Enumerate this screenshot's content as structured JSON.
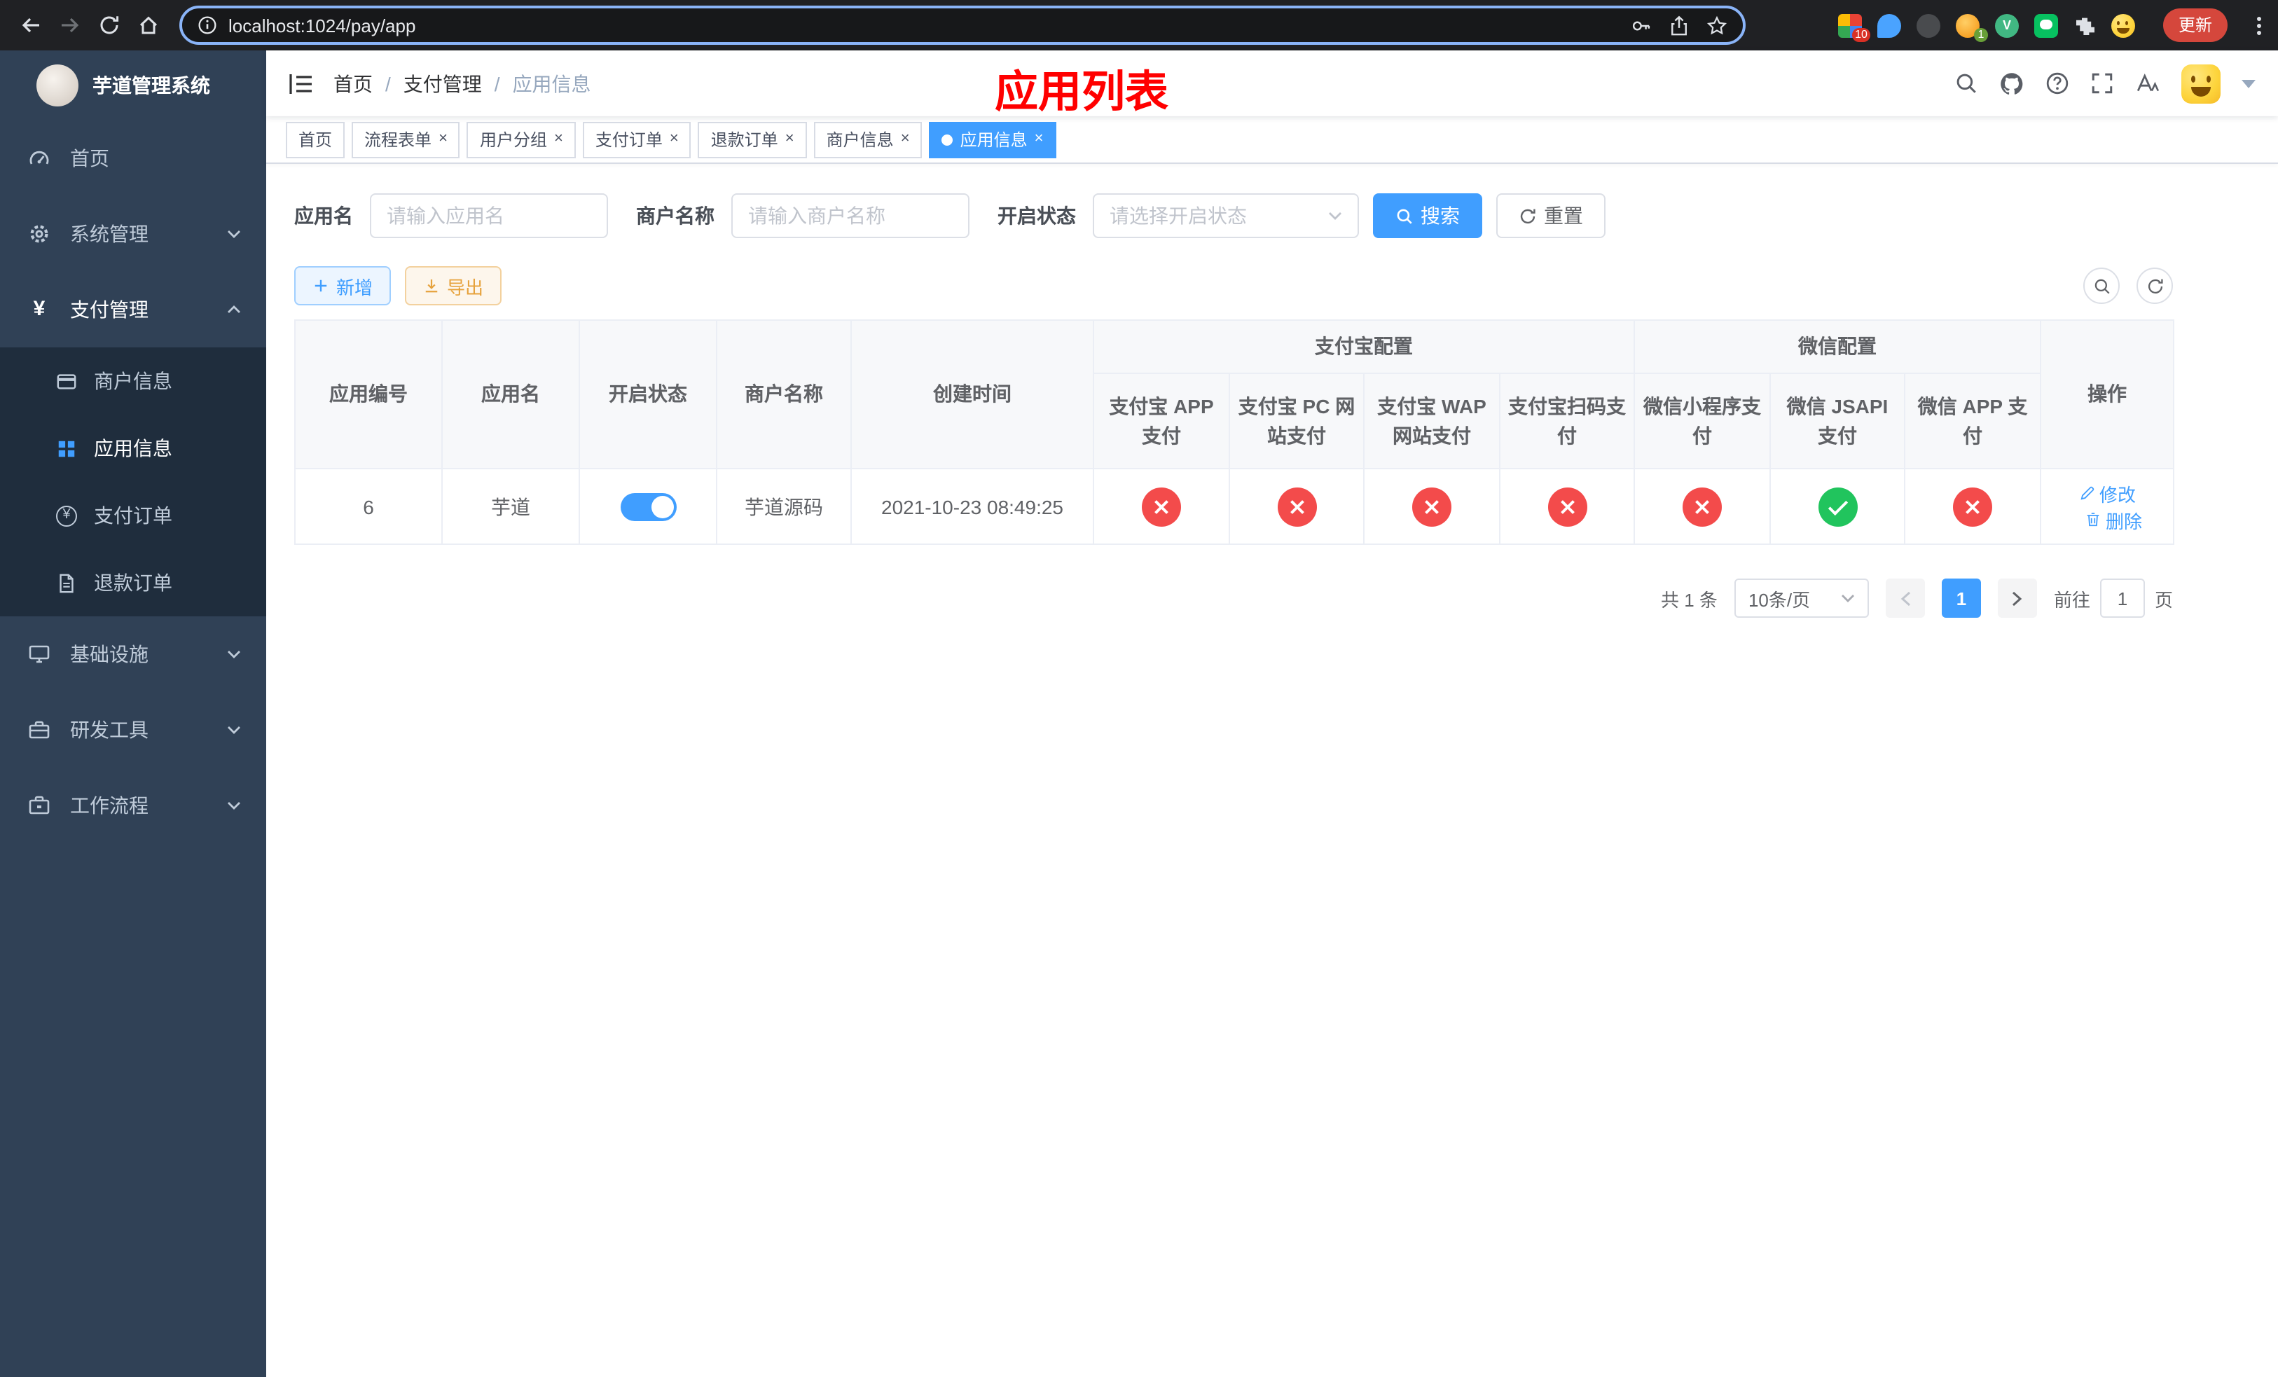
{
  "colors": {
    "primary": "#409eff",
    "danger": "#f34b4b",
    "success": "#21c45d",
    "warning": "#e6a23c",
    "annotation_red": "#ff0000",
    "sidebar_bg": "#304156",
    "submenu_bg": "#1f2d3d"
  },
  "browser": {
    "url": "localhost:1024/pay/app",
    "update_label": "更新",
    "extension_badges": {
      "grid": "10",
      "avatar": "1"
    }
  },
  "sidebar": {
    "title": "芋道管理系统",
    "items": [
      {
        "label": "首页",
        "icon": "dashboard-icon"
      },
      {
        "label": "系统管理",
        "icon": "gear-icon",
        "expandable": true,
        "expanded": false
      },
      {
        "label": "支付管理",
        "icon": "yen-icon",
        "expandable": true,
        "expanded": true
      },
      {
        "label": "基础设施",
        "icon": "infrastructure-icon",
        "expandable": true,
        "expanded": false
      },
      {
        "label": "研发工具",
        "icon": "dev-tools-icon",
        "expandable": true,
        "expanded": false
      },
      {
        "label": "工作流程",
        "icon": "workflow-icon",
        "expandable": true,
        "expanded": false
      }
    ],
    "payment_submenu": [
      {
        "label": "商户信息",
        "icon": "merchant-card-icon",
        "active": false
      },
      {
        "label": "应用信息",
        "icon": "app-grid-icon",
        "active": true
      },
      {
        "label": "支付订单",
        "icon": "pay-order-icon",
        "active": false
      },
      {
        "label": "退款订单",
        "icon": "refund-order-icon",
        "active": false
      }
    ]
  },
  "navbar": {
    "breadcrumb": [
      "首页",
      "支付管理",
      "应用信息"
    ],
    "annotation": "应用列表"
  },
  "tabs": [
    {
      "label": "首页",
      "closable": false,
      "active": false
    },
    {
      "label": "流程表单",
      "closable": true,
      "active": false
    },
    {
      "label": "用户分组",
      "closable": true,
      "active": false
    },
    {
      "label": "支付订单",
      "closable": true,
      "active": false
    },
    {
      "label": "退款订单",
      "closable": true,
      "active": false
    },
    {
      "label": "商户信息",
      "closable": true,
      "active": false
    },
    {
      "label": "应用信息",
      "closable": true,
      "active": true
    }
  ],
  "filters": {
    "app_name_label": "应用名",
    "app_name_placeholder": "请输入应用名",
    "merchant_label": "商户名称",
    "merchant_placeholder": "请输入商户名称",
    "status_label": "开启状态",
    "status_placeholder": "请选择开启状态",
    "search_label": "搜索",
    "reset_label": "重置"
  },
  "toolbar": {
    "add_label": "新增",
    "export_label": "导出"
  },
  "table": {
    "headers": {
      "app_id": "应用编号",
      "app_name": "应用名",
      "status": "开启状态",
      "merchant": "商户名称",
      "created": "创建时间",
      "alipay_group": "支付宝配置",
      "wechat_group": "微信配置",
      "actions": "操作",
      "sub": [
        "支付宝 APP 支付",
        "支付宝 PC 网站支付",
        "支付宝 WAP 网站支付",
        "支付宝扫码支付",
        "微信小程序支付",
        "微信 JSAPI 支付",
        "微信 APP 支付"
      ]
    },
    "rows": [
      {
        "app_id": "6",
        "app_name": "芋道",
        "status_on": true,
        "merchant": "芋道源码",
        "created": "2021-10-23 08:49:25",
        "pay_channels": [
          "no",
          "no",
          "no",
          "no",
          "no",
          "yes",
          "no"
        ],
        "edit_label": "修改",
        "delete_label": "删除"
      }
    ]
  },
  "pagination": {
    "total": "共 1 条",
    "page_size": "10条/页",
    "current_page": "1",
    "goto_prefix": "前往",
    "goto_value": "1",
    "goto_suffix": "页"
  }
}
